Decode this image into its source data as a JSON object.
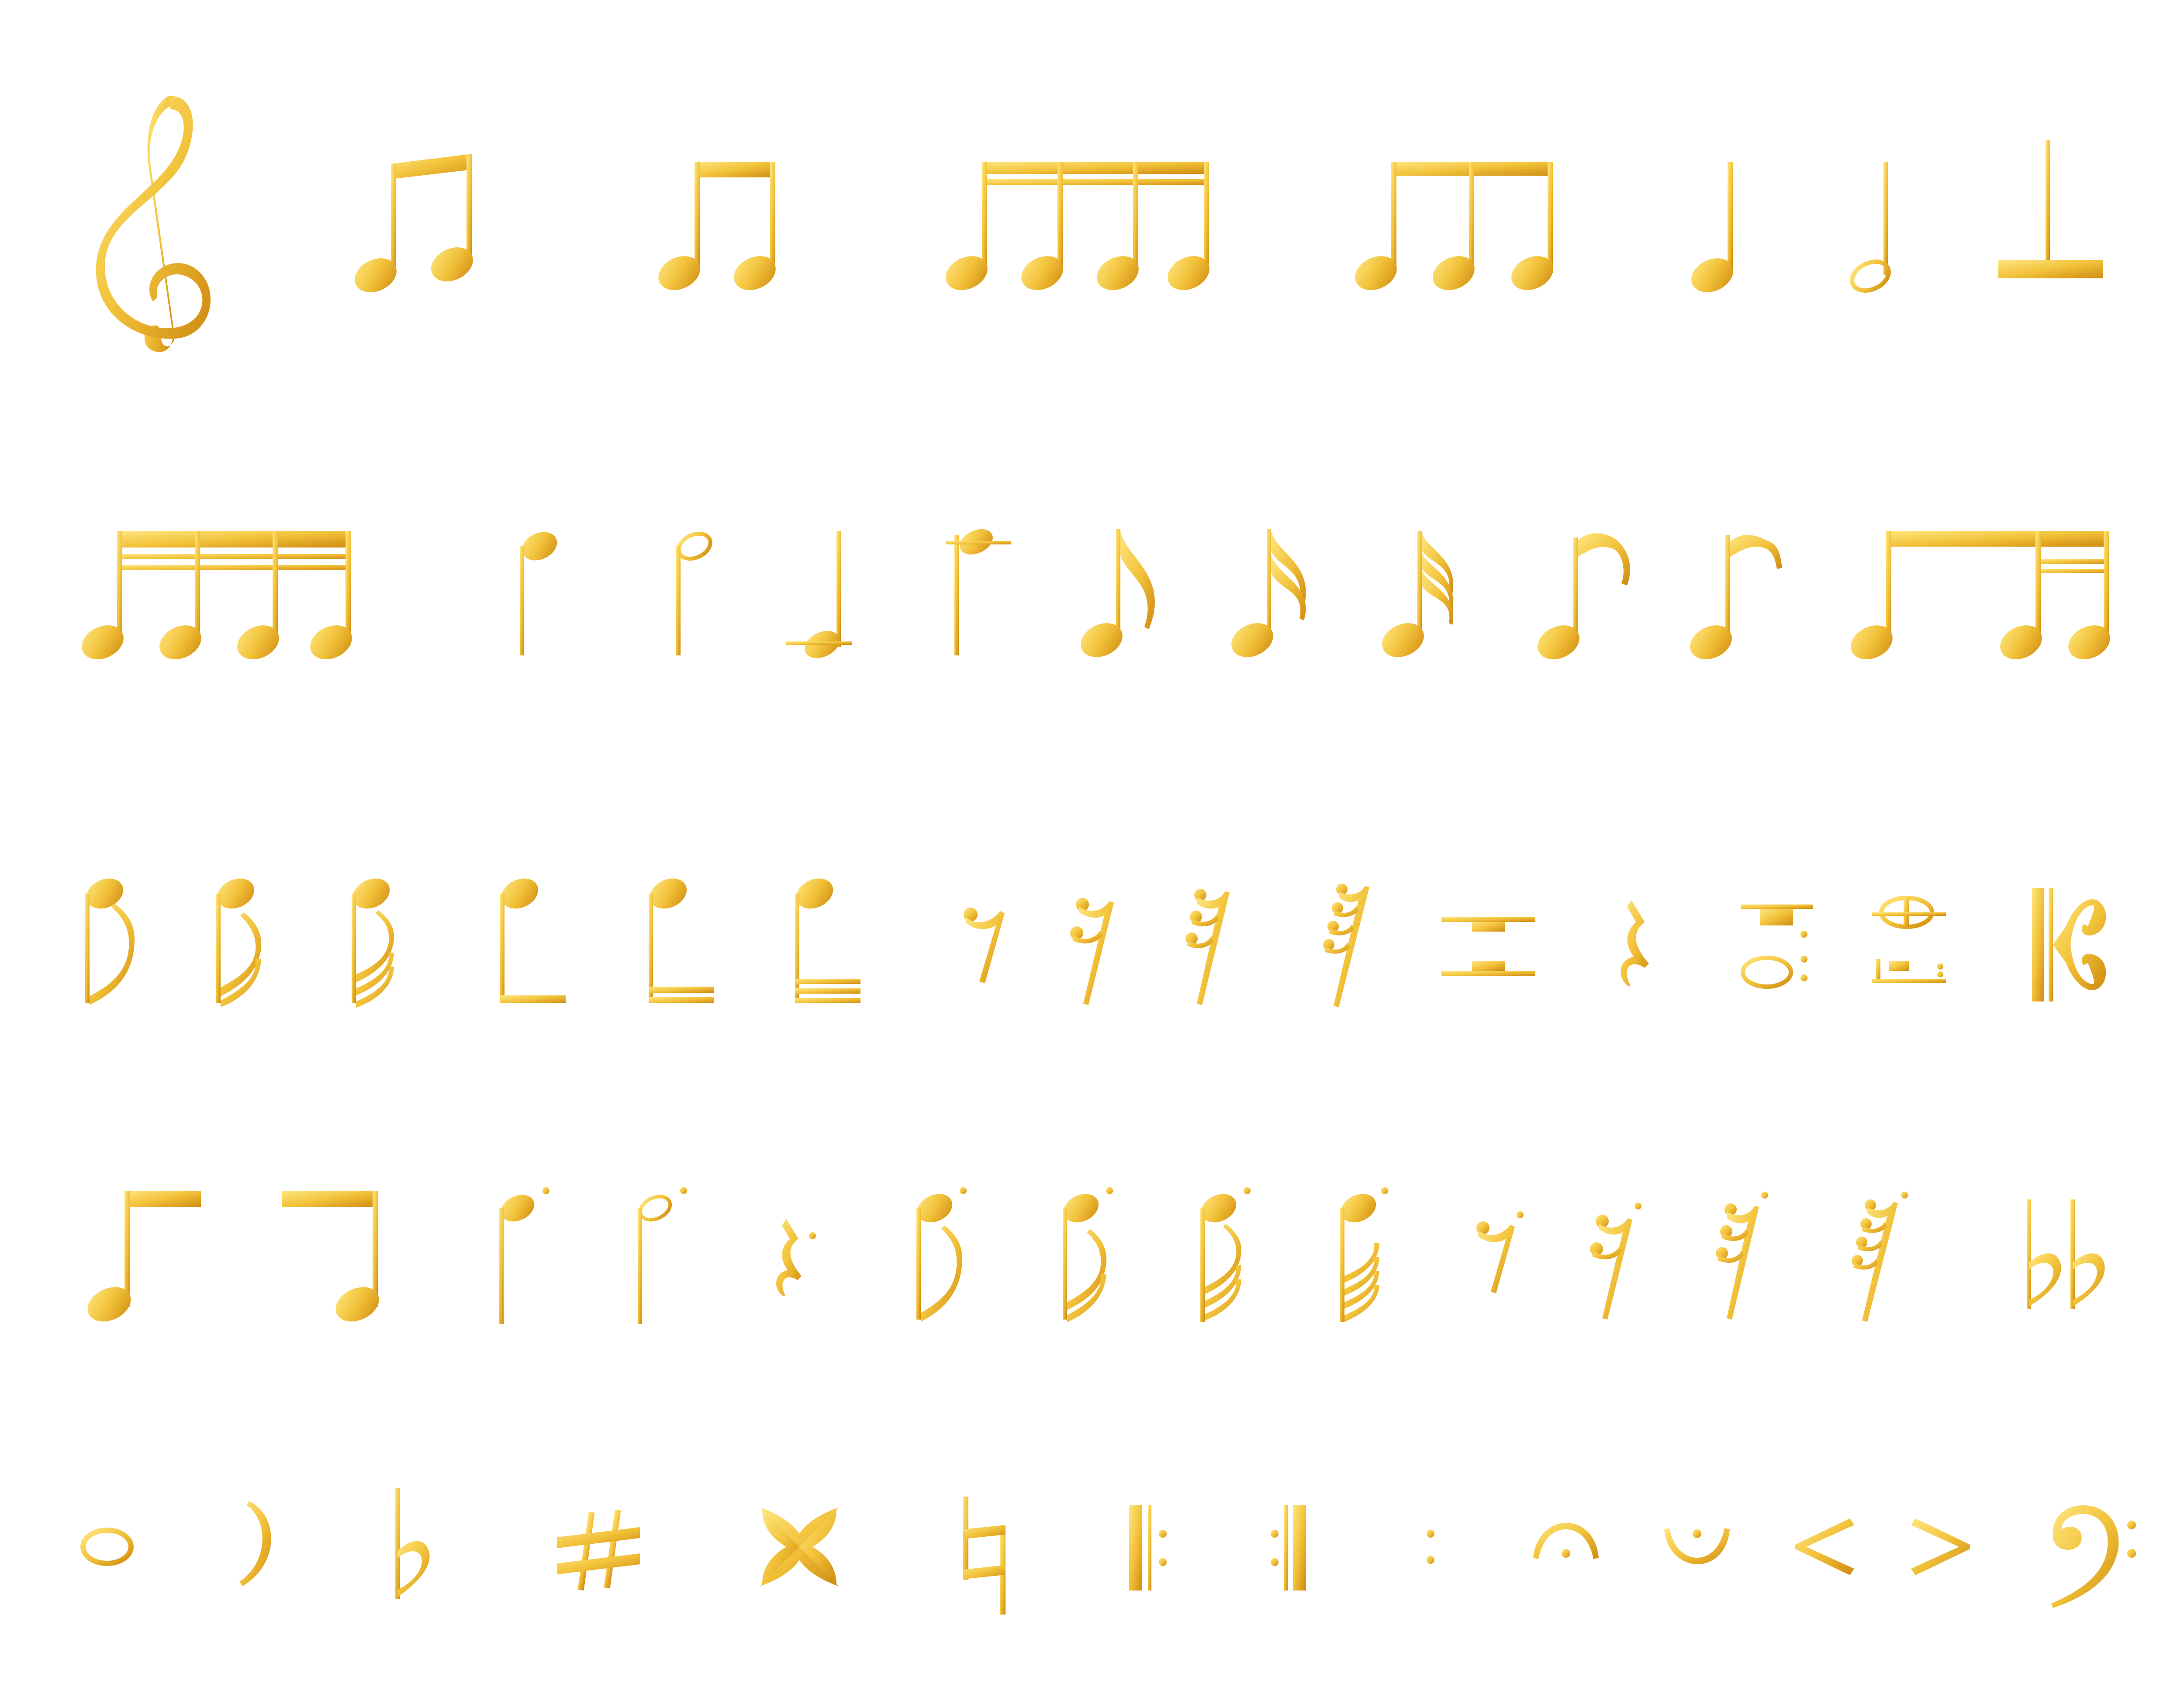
{
  "palette": {
    "gold_light": "#ffe680",
    "gold_mid": "#f2c23a",
    "gold_dark": "#cf8a10",
    "background": "#ffffff"
  },
  "symbols": [
    [
      "treble-clef-icon",
      "two-beamed-eighth-notes-slanted-icon",
      "two-beamed-eighth-notes-icon",
      "four-beamed-sixteenth-notes-icon",
      "three-beamed-eighth-notes-icon",
      "quarter-note-icon",
      "half-note-icon",
      "half-rest-icon"
    ],
    [
      "four-beamed-thirty-second-notes-icon",
      "quarter-note-stem-down-icon",
      "half-note-stem-down-icon",
      "quarter-note-ledger-icon",
      "half-note-ledger-icon",
      "eighth-note-icon",
      "sixteenth-note-icon",
      "thirty-second-note-icon",
      "eighth-note-hook-icon",
      "eighth-note-hook-alt-icon",
      "eighth-sixteenth-beamed-icon"
    ],
    [
      "eighth-note-stem-down-icon",
      "sixteenth-note-stem-down-icon",
      "thirty-second-note-stem-down-icon",
      "eighth-note-bracket-icon",
      "sixteenth-note-bracket-icon",
      "thirty-second-note-bracket-icon",
      "eighth-rest-icon",
      "sixteenth-rest-icon",
      "thirty-second-rest-icon",
      "sixty-fourth-rest-icon",
      "whole-half-rest-icon",
      "quarter-rest-icon",
      "dotted-whole-note-ledger-icon",
      "whole-note-ledger-icon",
      "alto-clef-icon"
    ],
    [
      "eighth-note-flag-left-icon",
      "eighth-note-flag-right-icon",
      "dotted-quarter-note-stem-down-icon",
      "dotted-half-note-stem-down-icon",
      "dotted-quarter-rest-icon",
      "dotted-eighth-note-stem-down-icon",
      "dotted-sixteenth-note-stem-down-icon",
      "dotted-thirty-second-note-stem-down-icon",
      "dotted-sixty-fourth-note-stem-down-icon",
      "dotted-eighth-rest-icon",
      "dotted-sixteenth-rest-icon",
      "dotted-thirty-second-rest-icon",
      "dotted-sixty-fourth-rest-icon",
      "double-flat-icon"
    ],
    [
      "whole-note-icon",
      "tie-icon",
      "flat-icon",
      "sharp-icon",
      "double-sharp-icon",
      "natural-icon",
      "repeat-start-icon",
      "repeat-end-icon",
      "colon-dots-icon",
      "fermata-icon",
      "fermata-inverted-icon",
      "crescendo-icon",
      "decrescendo-icon",
      "bass-clef-icon"
    ]
  ]
}
